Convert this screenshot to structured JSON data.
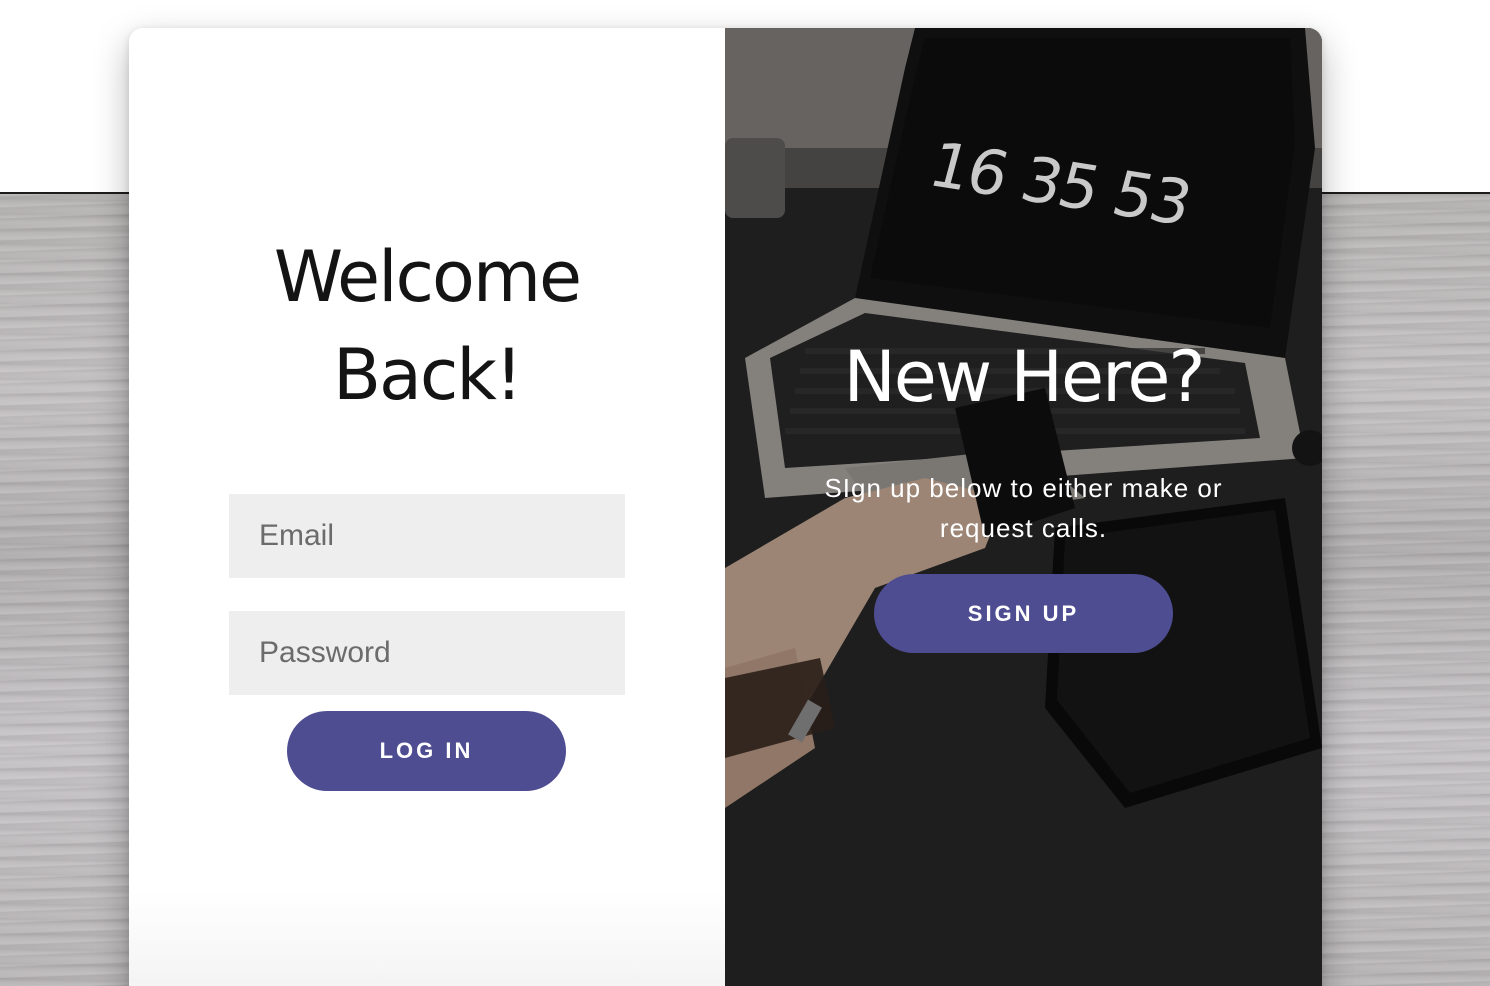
{
  "login": {
    "title_line1": "Welcome",
    "title_line2": "Back!",
    "email_placeholder": "Email",
    "password_placeholder": "Password",
    "login_button": "LOG IN"
  },
  "signup": {
    "title": "New Here?",
    "text_line1": "SIgn up below to either make or",
    "text_line2": "request calls.",
    "signup_button": "SIGN UP"
  },
  "photo": {
    "laptop_clock": "16 35 53"
  },
  "colors": {
    "accent": "#4f4d92",
    "field_background": "#eeeeee",
    "photo_dark": "#1f1f1f"
  }
}
